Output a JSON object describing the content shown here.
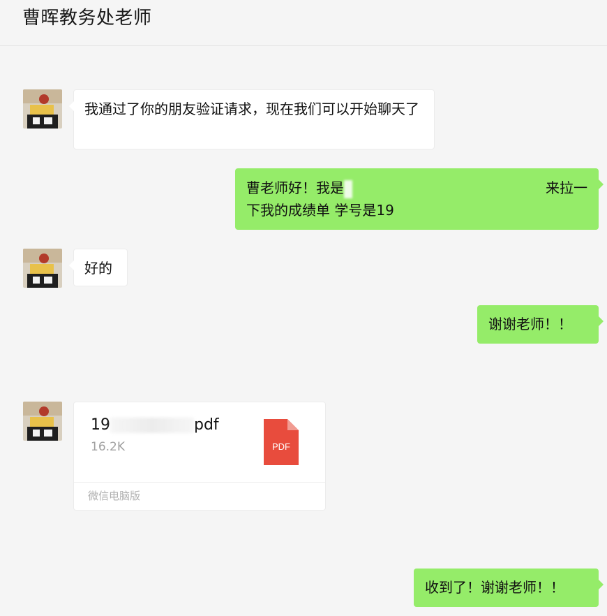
{
  "chat": {
    "title": "曹晖教务处老师"
  },
  "messages": {
    "m1_text": "我通过了你的朋友验证请求，现在我们可以开始聊天了",
    "m2_line1_start": "曹老师好！我是",
    "m2_line1_end": "来拉一",
    "m2_line2": "下我的成绩单 学号是19",
    "m3_text": "好的",
    "m4_text": "谢谢老师！！",
    "m6_text": "收到了！谢谢老师！！"
  },
  "file": {
    "name_prefix": "19",
    "name_suffix": "pdf",
    "size": "16.2K",
    "icon_label": "PDF",
    "source": "微信电脑版"
  },
  "colors": {
    "outgoing_bubble": "#95ec69",
    "incoming_bubble": "#ffffff",
    "background": "#f5f5f5",
    "pdf_icon": "#e84c3d"
  }
}
